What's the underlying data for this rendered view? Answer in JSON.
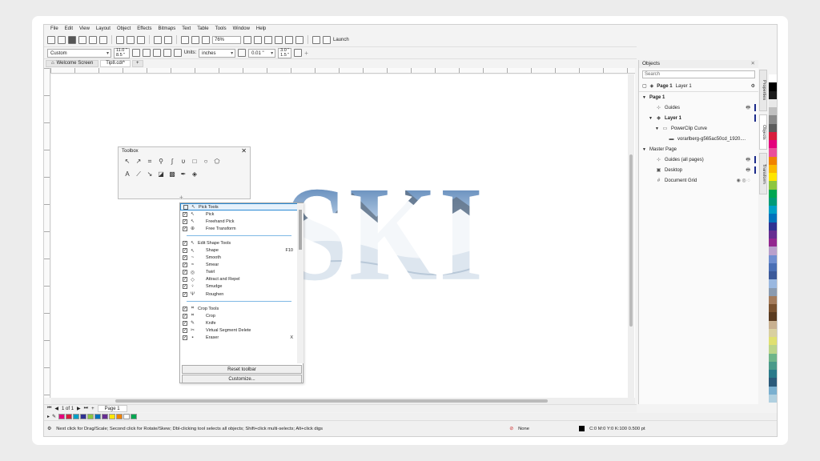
{
  "menu": [
    "File",
    "Edit",
    "View",
    "Layout",
    "Object",
    "Effects",
    "Bitmaps",
    "Text",
    "Table",
    "Tools",
    "Window",
    "Help"
  ],
  "toolbar": {
    "zoom": "76%",
    "launch_label": "Launch"
  },
  "propbar": {
    "page_preset": "Custom",
    "width": "11.0 \"",
    "height": "8.5 \"",
    "units_label": "Units:",
    "units": "inches",
    "nudge": "0.01 \"",
    "dup_x": "3.0 \"",
    "dup_y": "1.5 \""
  },
  "tabs": {
    "welcome": "Welcome Screen",
    "doc": "Tip8.cdr*"
  },
  "canvas": {
    "art_text": "SKI"
  },
  "toolbox": {
    "title": "Toolbox"
  },
  "custom_menu": {
    "groups": [
      {
        "items": [
          {
            "label": "Pick Tools",
            "checked": false,
            "head": true,
            "icon": "↖"
          },
          {
            "label": "Pick",
            "checked": true,
            "icon": "↖"
          },
          {
            "label": "Freehand Pick",
            "checked": true,
            "icon": "↖"
          },
          {
            "label": "Free Transform",
            "checked": true,
            "icon": "⊕"
          }
        ]
      },
      {
        "items": [
          {
            "label": "Edit Shape Tools",
            "checked": true,
            "icon": "↖"
          },
          {
            "label": "Shape",
            "checked": true,
            "icon": "↖",
            "key": "F10"
          },
          {
            "label": "Smooth",
            "checked": true,
            "icon": "~"
          },
          {
            "label": "Smear",
            "checked": true,
            "icon": "≈"
          },
          {
            "label": "Twirl",
            "checked": true,
            "icon": "◎"
          },
          {
            "label": "Attract and Repel",
            "checked": true,
            "icon": "◇"
          },
          {
            "label": "Smudge",
            "checked": true,
            "icon": "♀"
          },
          {
            "label": "Roughen",
            "checked": true,
            "icon": "Ψ"
          }
        ]
      },
      {
        "items": [
          {
            "label": "Crop Tools",
            "checked": true,
            "icon": "⌗"
          },
          {
            "label": "Crop",
            "checked": true,
            "icon": "⌗"
          },
          {
            "label": "Knife",
            "checked": true,
            "icon": "✎"
          },
          {
            "label": "Virtual Segment Delete",
            "checked": true,
            "icon": "✂"
          },
          {
            "label": "Eraser",
            "checked": true,
            "icon": "▪",
            "key": "X"
          }
        ]
      }
    ],
    "reset_label": "Reset toolbar",
    "customize_label": "Customize..."
  },
  "objects": {
    "title": "Objects",
    "search_placeholder": "Search",
    "page_label": "Page 1",
    "layer_label": "Layer 1",
    "tree": [
      {
        "label": "Page 1",
        "indent": 0,
        "bold": true,
        "tri": "▼"
      },
      {
        "label": "Guides",
        "indent": 1,
        "icon": "⊹",
        "right": "🖶",
        "bar": true
      },
      {
        "label": "Layer 1",
        "indent": 1,
        "bold": true,
        "tri": "▼",
        "icon": "◈",
        "bar": true
      },
      {
        "label": "PowerClip Curve",
        "indent": 2,
        "tri": "▼",
        "icon": "▭"
      },
      {
        "label": "vorarlberg-g565ac50cd_1920....",
        "indent": 3,
        "icon": "▬"
      },
      {
        "label": "Master Page",
        "indent": 0,
        "tri": "▼"
      },
      {
        "label": "Guides (all pages)",
        "indent": 1,
        "icon": "⊹",
        "right": "🖶",
        "bar": true
      },
      {
        "label": "Desktop",
        "indent": 1,
        "icon": "▣",
        "right": "🖶",
        "bar": true
      },
      {
        "label": "Document Grid",
        "indent": 1,
        "icon": "#",
        "right": "◉ ◎ ◌"
      }
    ],
    "side_tabs": [
      "Properties",
      "Objects",
      "Transform"
    ]
  },
  "pages": {
    "counter": "1 of 1",
    "page_tab": "Page 1"
  },
  "status": {
    "hint": "Next click for Drag/Scale; Second click for Rotate/Skew; Dbl-clicking tool selects all objects; Shift+click multi-selects; Alt+click digs",
    "fill": "None",
    "outline": "C:0 M:0 Y:0 K:100  0.500 pt"
  },
  "colors": {
    "palette": [
      "#ffffff",
      "#000000",
      "#1a1a1a",
      "#e8e8e8",
      "#c0c0c0",
      "#8a8a8a",
      "#5c5c5c",
      "#d81e3c",
      "#e4007c",
      "#ea4e9a",
      "#f08200",
      "#fbb900",
      "#ffe600",
      "#8cc63f",
      "#00a651",
      "#009b77",
      "#00a0c6",
      "#0072bc",
      "#2e3192",
      "#662d91",
      "#92278f",
      "#b9a0cc",
      "#6f8ed0",
      "#4a6fb5",
      "#3c5a9a",
      "#9ab8e0",
      "#8a9bb0",
      "#a47c5c",
      "#7a5230",
      "#5a3b20",
      "#c8b090",
      "#d9d0a0",
      "#e0e070",
      "#bbd58a",
      "#6fb58a",
      "#4a9a8a",
      "#2a7a8a",
      "#2a5a7a",
      "#7ab0d0",
      "#b0d0e0"
    ],
    "swatches": [
      "#e4007c",
      "#d81e3c",
      "#00a0c6",
      "#2e3192",
      "#8cc63f",
      "#0072bc",
      "#662d91",
      "#ffe600",
      "#f08200",
      "#ffffff",
      "#00a651"
    ]
  }
}
